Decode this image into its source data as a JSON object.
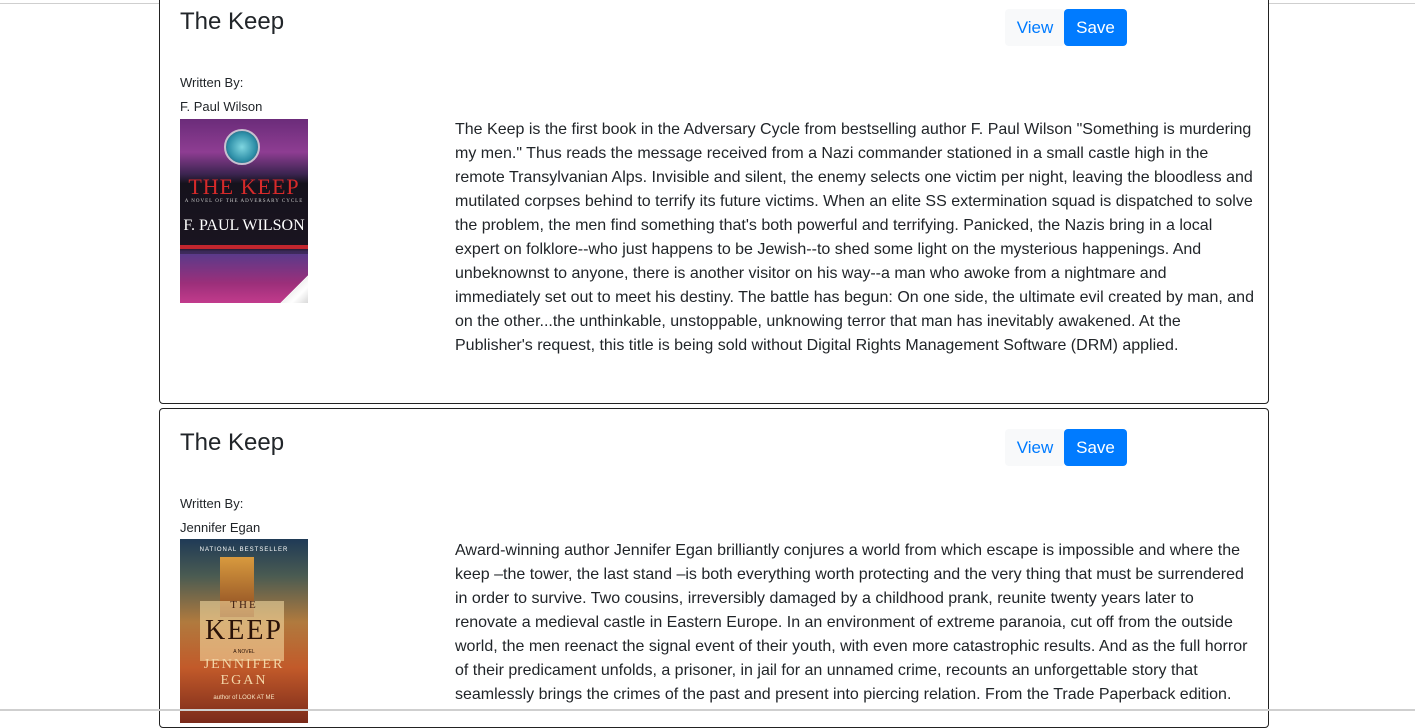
{
  "books": [
    {
      "title": "The Keep",
      "view_label": "View",
      "save_label": "Save",
      "written_by_label": "Written By:",
      "author": "F. Paul Wilson",
      "cover_text": {
        "title": "THE KEEP",
        "subtitle": "A NOVEL OF THE ADVERSARY CYCLE",
        "author": "F. PAUL WILSON"
      },
      "description": "The Keep is the first book in the Adversary Cycle from bestselling author F. Paul Wilson \"Something is murdering my men.\" Thus reads the message received from a Nazi commander stationed in a small castle high in the remote Transylvanian Alps. Invisible and silent, the enemy selects one victim per night, leaving the bloodless and mutilated corpses behind to terrify its future victims. When an elite SS extermination squad is dispatched to solve the problem, the men find something that's both powerful and terrifying. Panicked, the Nazis bring in a local expert on folklore--who just happens to be Jewish--to shed some light on the mysterious happenings. And unbeknownst to anyone, there is another visitor on his way--a man who awoke from a nightmare and immediately set out to meet his destiny. The battle has begun: On one side, the ultimate evil created by man, and on the other...the unthinkable, unstoppable, unknowing terror that man has inevitably awakened. At the Publisher's request, this title is being sold without Digital Rights Management Software (DRM) applied."
    },
    {
      "title": "The Keep",
      "view_label": "View",
      "save_label": "Save",
      "written_by_label": "Written By:",
      "author": "Jennifer Egan",
      "cover_text": {
        "badge": "NATIONAL BESTSELLER",
        "the": "THE",
        "title": "KEEP",
        "novel": "A NOVEL",
        "author_first": "JENNIFER",
        "author_last": "EGAN",
        "tagline": "author of LOOK AT ME"
      },
      "description": "Award-winning author Jennifer Egan brilliantly conjures a world from which escape is impossible and where the keep –the tower, the last stand –is both everything worth protecting and the very thing that must be surrendered in order to survive. Two cousins, irreversibly damaged by a childhood prank, reunite twenty years later to renovate a medieval castle in Eastern Europe. In an environment of extreme paranoia, cut off from the outside world, the men reenact the signal event of their youth, with even more catastrophic results. And as the full horror of their predicament unfolds, a prisoner, in jail for an unnamed crime, recounts an unforgettable story that seamlessly brings the crimes of the past and present into piercing relation. From the Trade Paperback edition."
    }
  ]
}
